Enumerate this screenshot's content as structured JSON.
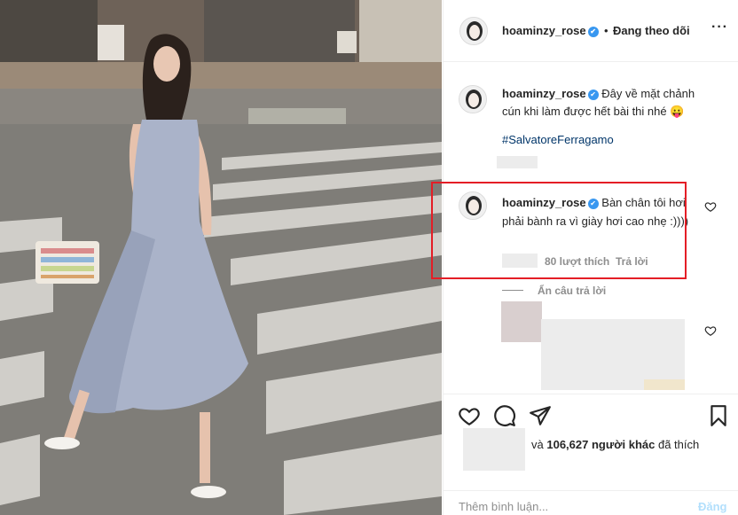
{
  "post": {
    "username": "hoaminzy_rose",
    "follow_status": "Đang theo dõi",
    "separator": "•",
    "more_icon": "more-horizontal-icon",
    "verified_icon": "verified-badge-icon"
  },
  "caption": {
    "username": "hoaminzy_rose",
    "text": "Đây về mặt chảnh cún khi làm được hết bài thi nhé 😛",
    "hashtag": "#SalvatoreFerragamo"
  },
  "comment": {
    "username": "hoaminzy_rose",
    "text": "Bàn chân tôi hơi phải bành ra vì giày hơi cao nhẹ :))))",
    "likes": "80 lượt thích",
    "reply": "Trả lời",
    "highlight_color": "#e41e26"
  },
  "replies": {
    "hide_label": "Ẩn câu trả lời"
  },
  "actions": {
    "like_icon": "heart-icon",
    "comment_icon": "comment-bubble-icon",
    "share_icon": "paper-plane-icon",
    "save_icon": "bookmark-icon",
    "liked_by_prefix": "và",
    "liked_by_count": "106,627 người khác",
    "liked_by_suffix": "đã thích"
  },
  "add_comment": {
    "placeholder": "Thêm bình luận...",
    "post_label": "Đăng"
  },
  "colors": {
    "link": "#003569",
    "muted": "#8e8e8e",
    "verified": "#3897f0",
    "post_disabled": "#b2dffc"
  }
}
